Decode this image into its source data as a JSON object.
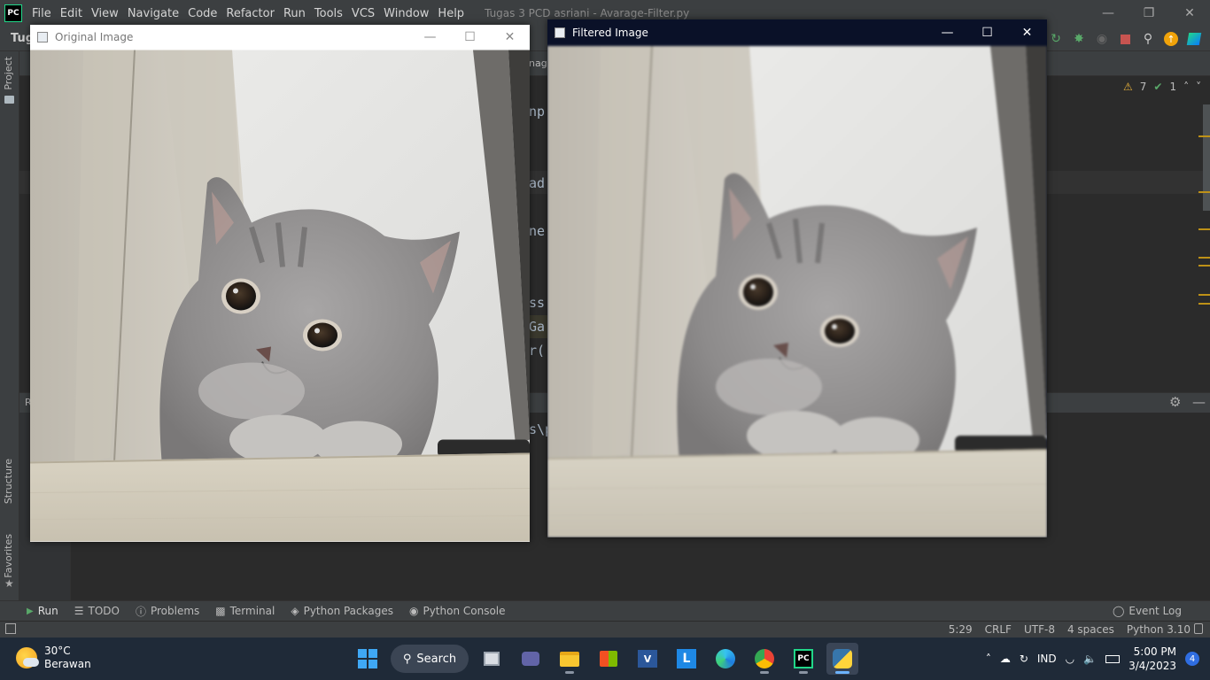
{
  "ide": {
    "logo_text": "PC",
    "menu": [
      "File",
      "Edit",
      "View",
      "Navigate",
      "Code",
      "Refactor",
      "Run",
      "Tools",
      "VCS",
      "Window",
      "Help"
    ],
    "title": "Tugas 3 PCD asriani - Avarage-Filter.py",
    "project_label": "Tug",
    "editor_tab_fragment": "nag",
    "code_fragments": [
      "np",
      "ad",
      "ne",
      "ss",
      "Ga",
      "r(",
      "s\\p"
    ],
    "inspections": {
      "warnings": "7",
      "ok": "1"
    },
    "side_tabs": {
      "project": "Project",
      "structure": "Structure",
      "favorites": "Favorites"
    },
    "run_header_fragment": "R"
  },
  "bottom_tabs": [
    {
      "label": "Run",
      "icon": "play-icon"
    },
    {
      "label": "TODO",
      "icon": "list-icon"
    },
    {
      "label": "Problems",
      "icon": "info-icon"
    },
    {
      "label": "Terminal",
      "icon": "terminal-icon"
    },
    {
      "label": "Python Packages",
      "icon": "packages-icon"
    },
    {
      "label": "Python Console",
      "icon": "python-icon"
    }
  ],
  "event_log": "Event Log",
  "status": {
    "position": "5:29",
    "line_sep": "CRLF",
    "encoding": "UTF-8",
    "indent": "4 spaces",
    "interpreter": "Python 3.10"
  },
  "windows": {
    "original": {
      "title": "Original Image"
    },
    "filtered": {
      "title": "Filtered Image"
    }
  },
  "taskbar": {
    "weather": {
      "temp": "30°C",
      "desc": "Berawan"
    },
    "search_label": "Search",
    "language": "IND",
    "time": "5:00 PM",
    "date": "3/4/2023",
    "notification_count": "4"
  },
  "colors": {
    "ide_bg": "#2b2b2b",
    "ide_panel": "#3c3f41",
    "accent_warning": "#be9117",
    "taskbar_bg": "#1f2a38",
    "filtered_titlebar": "#0a1128"
  }
}
